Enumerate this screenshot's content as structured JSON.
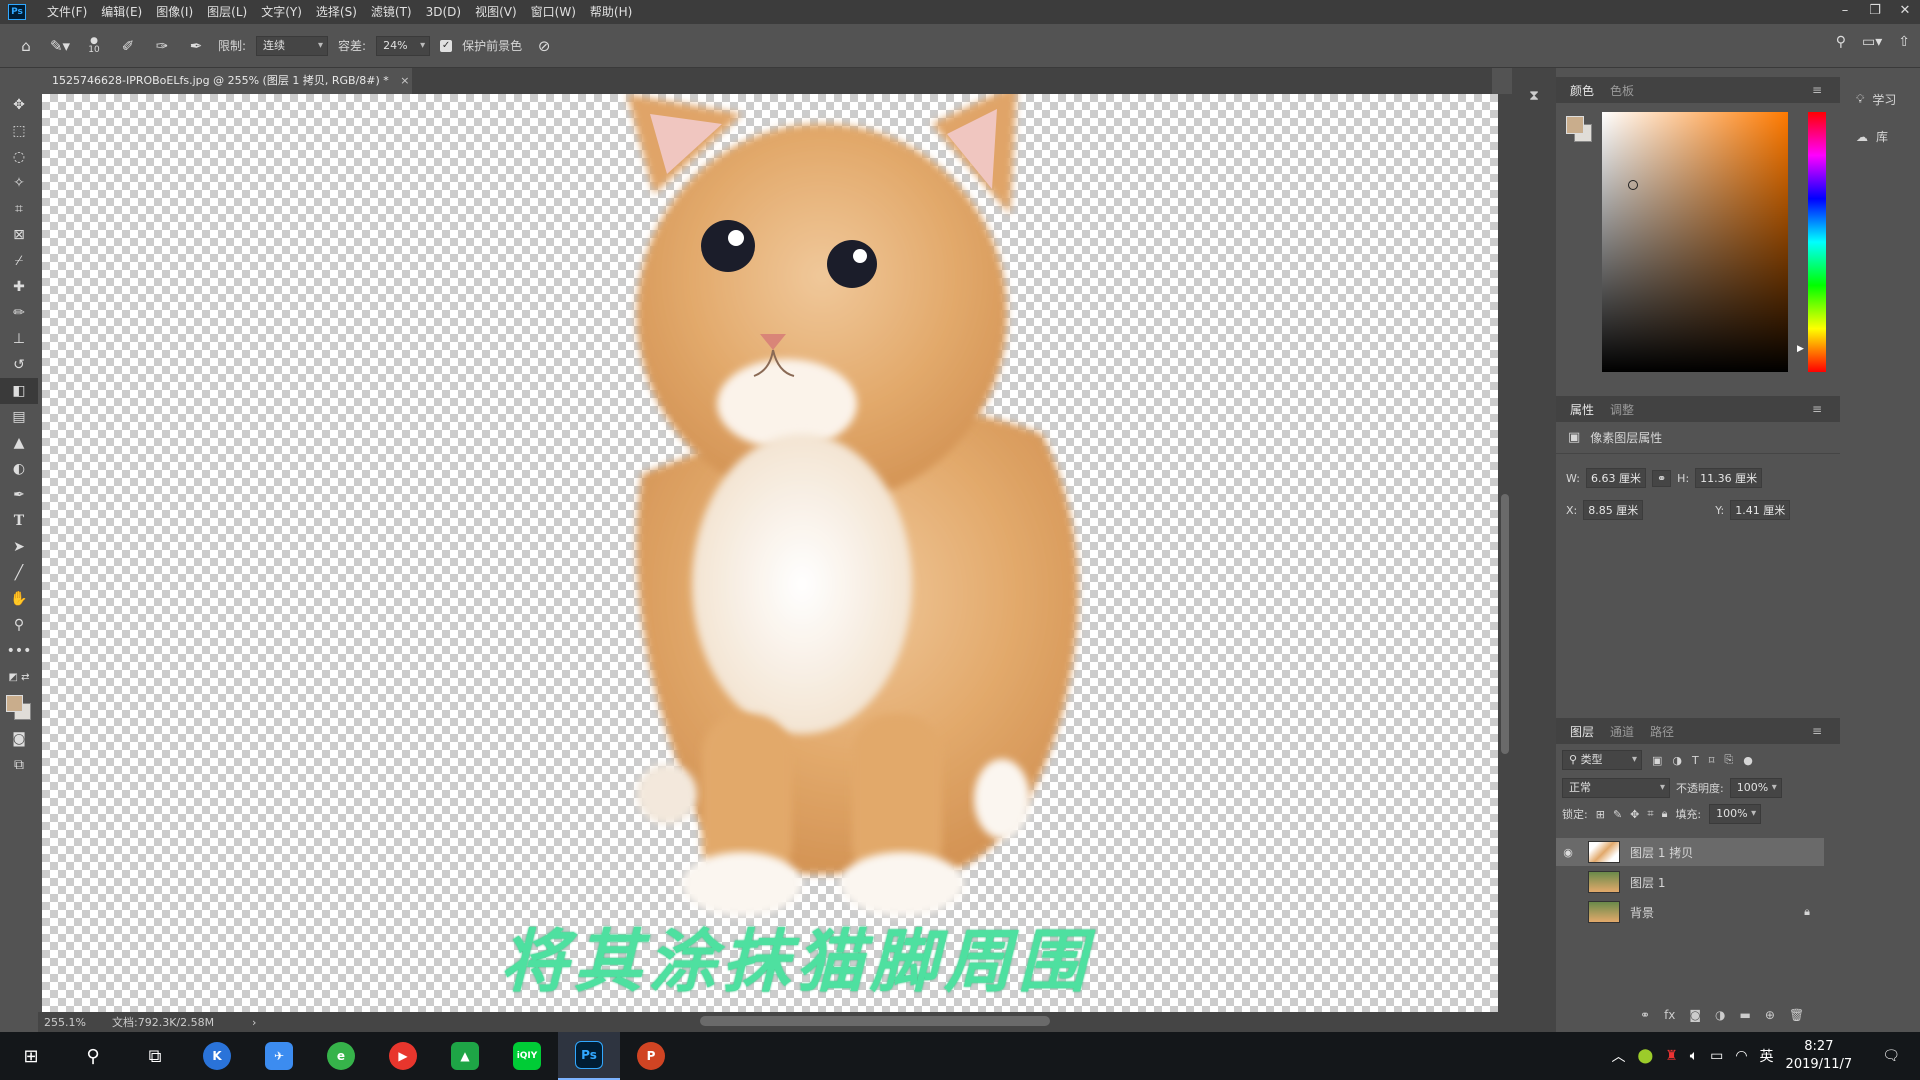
{
  "menubar": {
    "app_badge": "Ps",
    "items": [
      "文件(F)",
      "编辑(E)",
      "图像(I)",
      "图层(L)",
      "文字(Y)",
      "选择(S)",
      "滤镜(T)",
      "3D(D)",
      "视图(V)",
      "窗口(W)",
      "帮助(H)"
    ],
    "window_controls": [
      "–",
      "❐",
      "✕"
    ]
  },
  "options": {
    "brush_size": "10",
    "limit_label": "限制:",
    "limit_value": "连续",
    "tolerance_label": "容差:",
    "tolerance_value": "24%",
    "protect_fg_label": "保护前景色"
  },
  "document": {
    "tab_title": "1525746628-IPROBoELfs.jpg @ 255% (图层 1 拷贝, RGB/8#) *",
    "zoom": "255.1%",
    "doc_size": "文档:792.3K/2.58M"
  },
  "overlay_text": "将其涂抹猫脚周围",
  "color_panel": {
    "tabs": [
      "颜色",
      "色板"
    ],
    "fg_color": "#c9ad8c",
    "bg_color": "#e0ddd8"
  },
  "properties": {
    "tabs": [
      "属性",
      "调整"
    ],
    "title": "像素图层属性",
    "w_label": "W:",
    "w": "6.63 厘米",
    "h_label": "H:",
    "h": "11.36 厘米",
    "x_label": "X:",
    "x": "8.85 厘米",
    "y_label": "Y:",
    "y": "1.41 厘米"
  },
  "layers": {
    "tabs": [
      "图层",
      "通道",
      "路径"
    ],
    "filter": "类型",
    "blend_mode": "正常",
    "opacity_label": "不透明度:",
    "opacity": "100%",
    "lock_label": "锁定:",
    "fill_label": "填充:",
    "fill": "100%",
    "items": [
      {
        "name": "图层 1 拷贝",
        "visible": true
      },
      {
        "name": "图层 1",
        "visible": false
      },
      {
        "name": "背景",
        "visible": false
      }
    ]
  },
  "side_panel": {
    "learn": "学习",
    "library": "库"
  },
  "taskbar": {
    "ps_label": "Ps",
    "time": "8:27",
    "date": "2019/11/7",
    "ime": "英"
  }
}
